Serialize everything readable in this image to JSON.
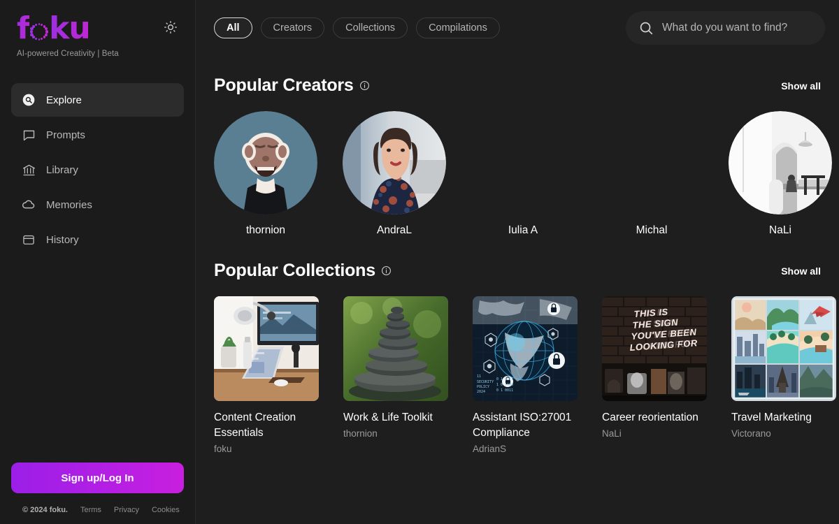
{
  "brand": {
    "name": "foku",
    "name_part1": "f",
    "name_part2": "ku",
    "tagline": "AI-powered Creativity | Beta",
    "accent_from": "#9b30e0",
    "accent_to": "#c026d3"
  },
  "theme_toggle": {
    "icon": "sun-icon"
  },
  "sidebar": {
    "items": [
      {
        "label": "Explore",
        "icon": "explore-search-circle-icon",
        "active": true
      },
      {
        "label": "Prompts",
        "icon": "chat-bubble-icon",
        "active": false
      },
      {
        "label": "Library",
        "icon": "bank-columns-icon",
        "active": false
      },
      {
        "label": "Memories",
        "icon": "cloud-icon",
        "active": false
      },
      {
        "label": "History",
        "icon": "calendar-icon",
        "active": false
      }
    ],
    "signup_label": "Sign up/Log In",
    "footer": {
      "copyright": "© 2024 foku.",
      "links": [
        "Terms",
        "Privacy",
        "Cookies"
      ]
    }
  },
  "topbar": {
    "filters": [
      {
        "label": "All",
        "active": true
      },
      {
        "label": "Creators",
        "active": false
      },
      {
        "label": "Collections",
        "active": false
      },
      {
        "label": "Compilations",
        "active": false
      }
    ],
    "search": {
      "placeholder": "What do you want to find?",
      "value": "",
      "icon": "search-icon"
    }
  },
  "sections": {
    "creators": {
      "title": "Popular Creators",
      "info_icon": "info-circle-icon",
      "show_all": "Show all",
      "items": [
        {
          "name": "thornion",
          "has_avatar": true,
          "avatar_desc": "cartoon ape portrait on blue background"
        },
        {
          "name": "AndraL",
          "has_avatar": true,
          "avatar_desc": "woman in floral blouse seated indoors"
        },
        {
          "name": "Iulia A",
          "has_avatar": false,
          "avatar_desc": ""
        },
        {
          "name": "Michal",
          "has_avatar": false,
          "avatar_desc": ""
        },
        {
          "name": "NaLi",
          "has_avatar": true,
          "avatar_desc": "white minimalist interior with arch and pendant lamp"
        }
      ]
    },
    "collections": {
      "title": "Popular Collections",
      "info_icon": "info-circle-icon",
      "show_all": "Show all",
      "items": [
        {
          "title": "Content Creation Essentials",
          "author": "foku",
          "thumb_desc": "laptop and monitor on wooden desk with plant and lamp"
        },
        {
          "title": "Work & Life Toolkit",
          "author": "thornion",
          "thumb_desc": "stacked zen stones against green bokeh"
        },
        {
          "title": "Assistant ISO:27001 Compliance",
          "author": "AdrianS",
          "thumb_desc": "digital globe with padlock cybersecurity icons"
        },
        {
          "title": "Career reorientation",
          "author": "NaLi",
          "thumb_desc": "neon sign on brick wall reading THIS IS THE SIGN YOU'VE BEEN LOOKING FOR"
        },
        {
          "title": "Travel Marketing",
          "author": "Victorano",
          "thumb_desc": "travel photo collage with Eiffel Tower, beach and plane"
        }
      ]
    }
  }
}
